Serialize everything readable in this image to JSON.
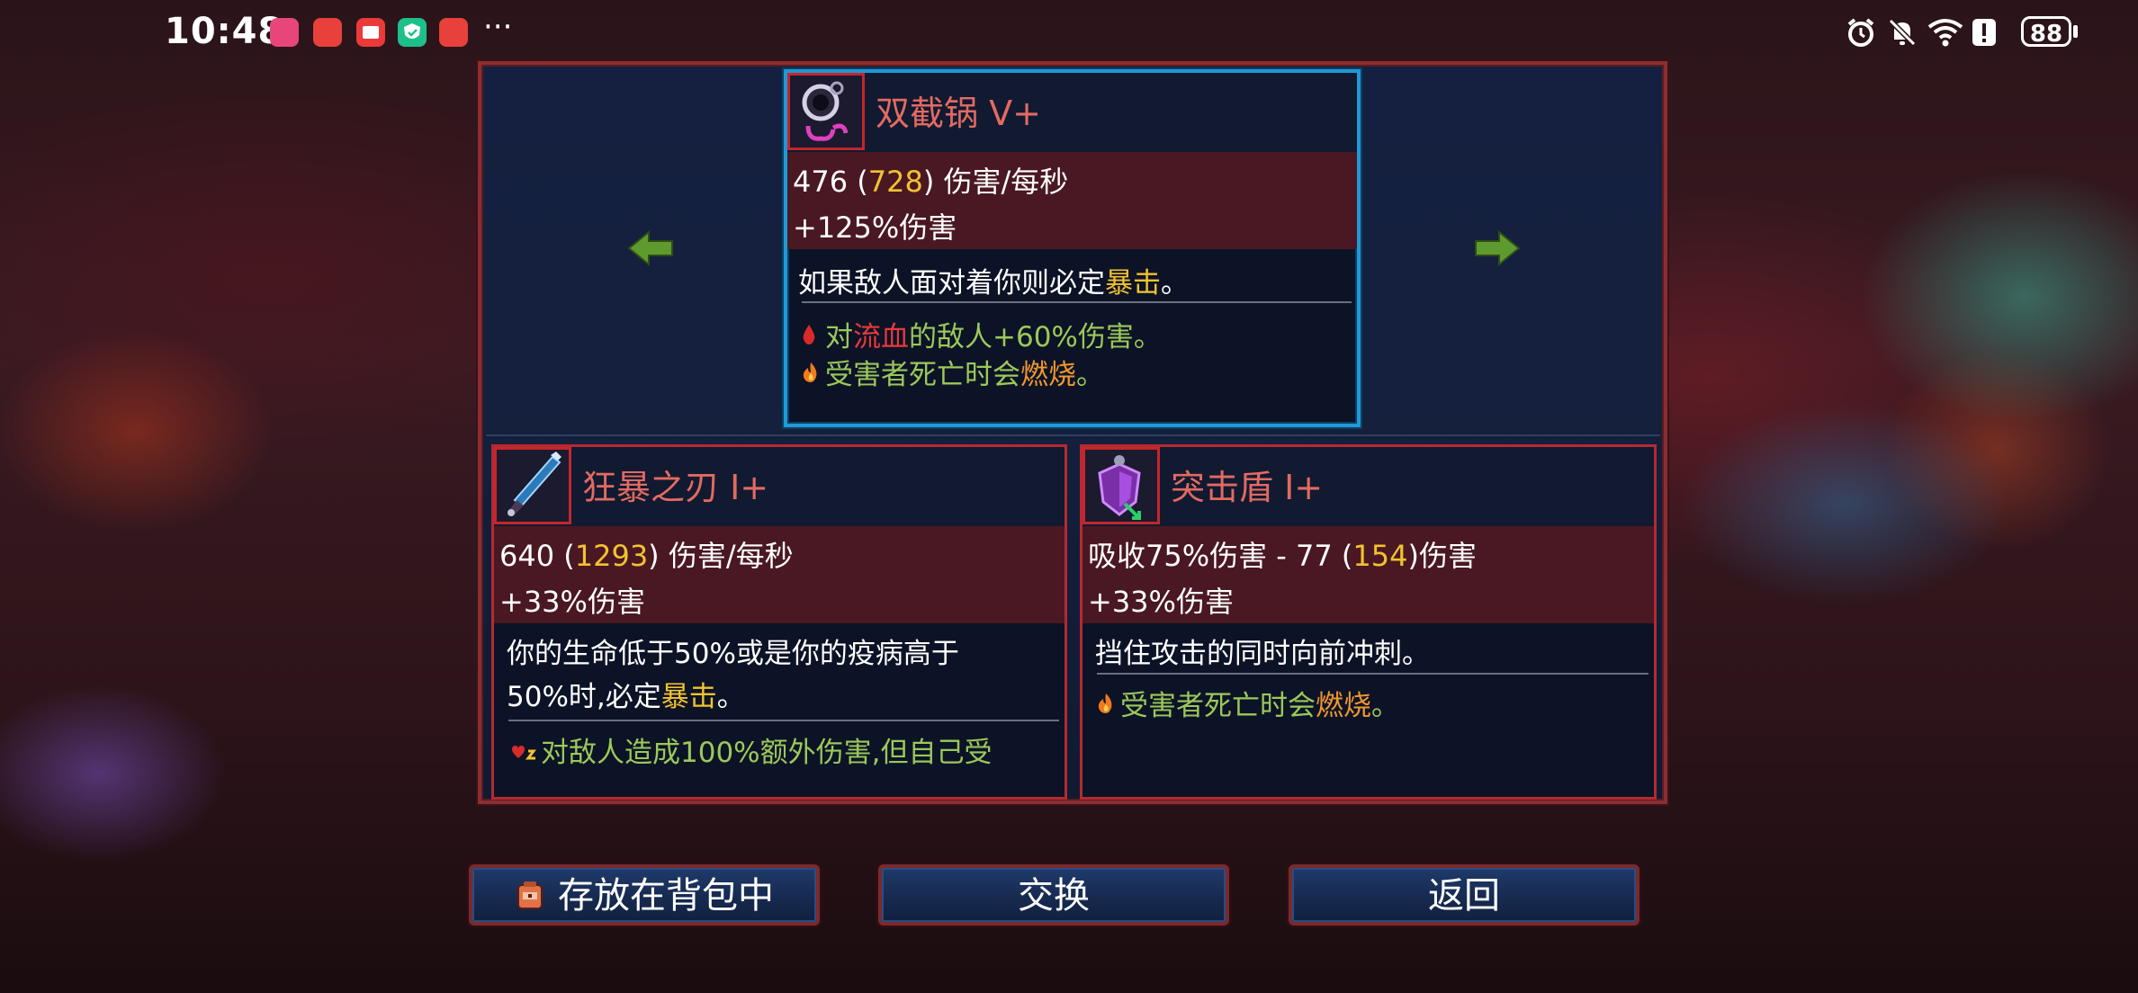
{
  "status_bar": {
    "time": "10:48",
    "more": "···",
    "battery": "88",
    "notification_icons": [
      "lelo-app-icon",
      "huawei-app-icon",
      "mail-app-icon",
      "shield-app-icon",
      "huawei-app-icon-2"
    ],
    "system_icons": [
      "alarm-icon",
      "silent-bell-icon",
      "wifi-icon",
      "alert-icon"
    ]
  },
  "comparison": {
    "current_item": {
      "name": "双截锅 V+",
      "dps": "476",
      "dps_crit": "728",
      "dps_label": "伤害/每秒",
      "damage_bonus": "+125%伤害",
      "description_pre": "如果敌人面对着你则必定",
      "description_hl": "暴击",
      "description_post": "。",
      "effects": [
        {
          "icon": "blood-drop-icon",
          "pre": "对",
          "hl": "流血",
          "post": "的敌人+60%伤害。",
          "hl_color": "#e8393a"
        },
        {
          "icon": "fire-icon",
          "pre": "受害者死亡时会",
          "hl": "燃烧",
          "post": "。",
          "hl_color": "#f0962e"
        }
      ]
    },
    "left_item": {
      "name": "狂暴之刃 I+",
      "dps": "640",
      "dps_crit": "1293",
      "dps_label": "伤害/每秒",
      "damage_bonus": "+33%伤害",
      "description_line1": "你的生命低于50%或是你的疫病高于",
      "description_pre": "50%时,必定",
      "description_hl": "暴击",
      "description_post": "。",
      "effect_text": "对敌人造成100%额外伤害,但自己受"
    },
    "right_item": {
      "name": "突击盾 I+",
      "absorb_pre": "吸收75%伤害 - 77 (",
      "absorb_value": "154",
      "absorb_post": ")伤害",
      "damage_bonus": "+33%伤害",
      "description": "挡住攻击的同时向前冲刺。",
      "effect_pre": "受害者死亡时会",
      "effect_hl": "燃烧",
      "effect_post": "。"
    },
    "prev_arrow_icon": "arrow-left-icon",
    "next_arrow_icon": "arrow-right-icon"
  },
  "buttons": {
    "store": "存放在背包中",
    "swap": "交换",
    "back": "返回"
  },
  "colors": {
    "accent_selected": "#1e9ad6",
    "card_border": "#b52a30",
    "highlight_yellow": "#f2c230",
    "effect_green": "#9cc85a"
  }
}
